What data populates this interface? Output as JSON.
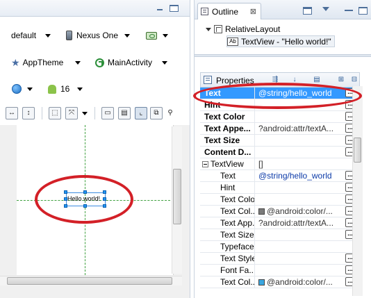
{
  "left_editor": {
    "toolbar_row1": {
      "config_combo": "default",
      "device_combo": "Nexus One",
      "orientation_icon": "screen-orientation-icon"
    },
    "toolbar_row2": {
      "theme_combo": "AppTheme",
      "activity_combo": "MainActivity"
    },
    "toolbar_row3": {
      "locale_icon": "globe-icon",
      "api_level_combo": "16"
    },
    "layout_tools": [
      "toggle-fill-width-icon",
      "toggle-fill-height-icon",
      "margins-icon",
      "resize-icon",
      "zoom-to-fit-icon",
      "zoom-100-icon",
      "emulate-real-size-icon",
      "zoom-in-icon"
    ],
    "canvas": {
      "textview_text": "Hello world!"
    }
  },
  "outline_panel": {
    "tab_label": "Outline",
    "close_glyph": "⊠",
    "tree": [
      {
        "label": "RelativeLayout",
        "icon": "relative-layout-icon"
      },
      {
        "label": "TextView - \"Hello world!\"",
        "icon": "textview-ab-icon"
      }
    ]
  },
  "properties_panel": {
    "header_label": "Properties",
    "rows": [
      {
        "name": "Text",
        "value": "@string/hello_world",
        "bold": true,
        "selected": true,
        "button": true
      },
      {
        "name": "Hint",
        "value": "",
        "bold": true,
        "button": true
      },
      {
        "name": "Text Color",
        "value": "",
        "bold": true,
        "button": true
      },
      {
        "name": "Text Appe...",
        "value": "?android:attr/textA...",
        "bold": true,
        "button": true
      },
      {
        "name": "Text Size",
        "value": "",
        "bold": true,
        "button": true
      },
      {
        "name": "Content D...",
        "value": "",
        "bold": true,
        "button": true
      },
      {
        "name": "TextView",
        "value": "[]",
        "group": true
      },
      {
        "name": "Text",
        "value": "@string/hello_world",
        "indent": true,
        "link": true,
        "button": true
      },
      {
        "name": "Hint",
        "value": "",
        "indent": true,
        "button": true
      },
      {
        "name": "Text Color",
        "value": "",
        "indent": true,
        "button": true
      },
      {
        "name": "Text Col...",
        "value": "@android:color/...",
        "indent": true,
        "swatch": "#7a7a7a",
        "button": true
      },
      {
        "name": "Text App...",
        "value": "?android:attr/textA...",
        "indent": true,
        "button": true
      },
      {
        "name": "Text Size",
        "value": "",
        "indent": true,
        "button": true
      },
      {
        "name": "Typeface",
        "value": "",
        "indent": true
      },
      {
        "name": "Text Style",
        "value": "",
        "indent": true,
        "button": true
      },
      {
        "name": "Font Fa...",
        "value": "",
        "indent": true,
        "button": true
      },
      {
        "name": "Text Col...",
        "value": "@android:color/...",
        "indent": true,
        "swatch": "#3aa6e0",
        "button": true
      }
    ],
    "button_glyph": "...",
    "header_tools": [
      "show-advanced-icon",
      "sort-alpha-icon",
      "filter-icon",
      "expand-all-icon",
      "collapse-all-icon"
    ]
  },
  "colors": {
    "selection": "#3399ff",
    "annotation_red": "#d32027",
    "guide_green": "#3fa03f",
    "handle_blue": "#2196f3"
  }
}
